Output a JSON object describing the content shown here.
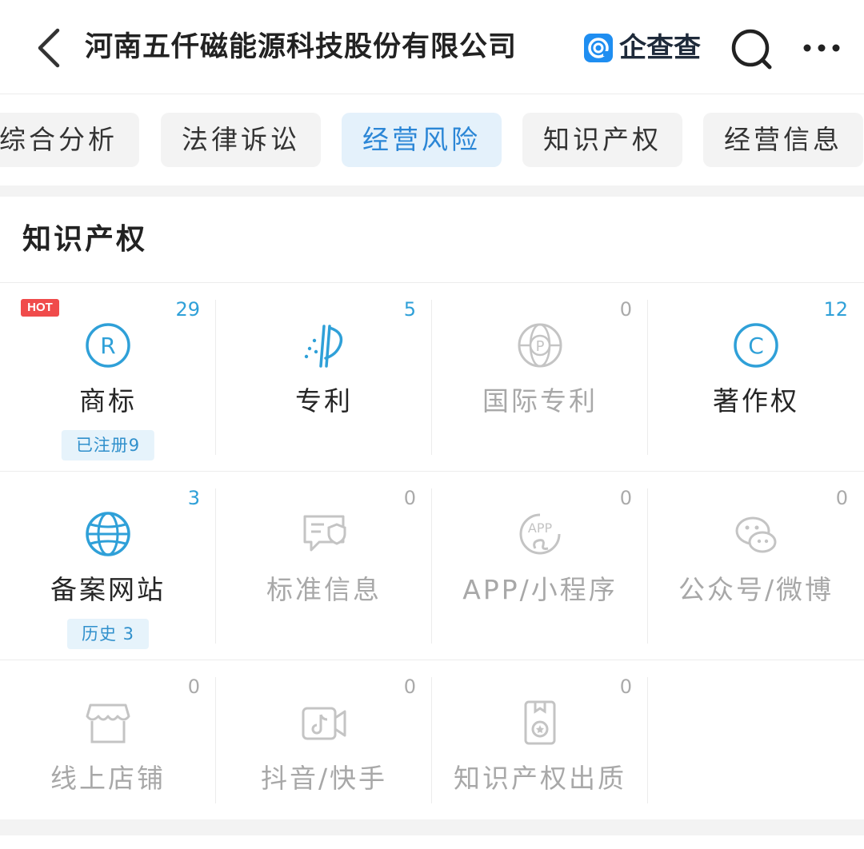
{
  "header": {
    "title": "河南五仟磁能源科技股份有限公司",
    "brand_name": "企查查"
  },
  "tabs": [
    {
      "label": "综合分析",
      "active": false
    },
    {
      "label": "法律诉讼",
      "active": false
    },
    {
      "label": "经营风险",
      "active": true
    },
    {
      "label": "知识产权",
      "active": false
    },
    {
      "label": "经营信息",
      "active": false
    }
  ],
  "section": {
    "title": "知识产权",
    "hot_badge": "HOT",
    "items": [
      {
        "label": "商标",
        "count": "29",
        "icon": "registered-trademark-icon",
        "tag": "已注册9"
      },
      {
        "label": "专利",
        "count": "5",
        "icon": "patent-icon"
      },
      {
        "label": "国际专利",
        "count": "0",
        "icon": "globe-patent-icon"
      },
      {
        "label": "著作权",
        "count": "12",
        "icon": "copyright-icon"
      },
      {
        "label": "备案网站",
        "count": "3",
        "icon": "globe-icon",
        "tag": "历史 3"
      },
      {
        "label": "标准信息",
        "count": "0",
        "icon": "standard-info-icon"
      },
      {
        "label": "APP/小程序",
        "count": "0",
        "icon": "app-icon"
      },
      {
        "label": "公众号/微博",
        "count": "0",
        "icon": "wechat-weibo-icon"
      },
      {
        "label": "线上店铺",
        "count": "0",
        "icon": "shop-icon"
      },
      {
        "label": "抖音/快手",
        "count": "0",
        "icon": "short-video-icon"
      },
      {
        "label": "知识产权出质",
        "count": "0",
        "icon": "ip-pledge-icon"
      }
    ]
  },
  "colors": {
    "accent": "#2fa0d8",
    "active_tab_bg": "#e4f1fb",
    "active_tab_text": "#2b86d6",
    "hot_badge": "#f04b4b",
    "disabled_text": "#a8a8a8"
  }
}
